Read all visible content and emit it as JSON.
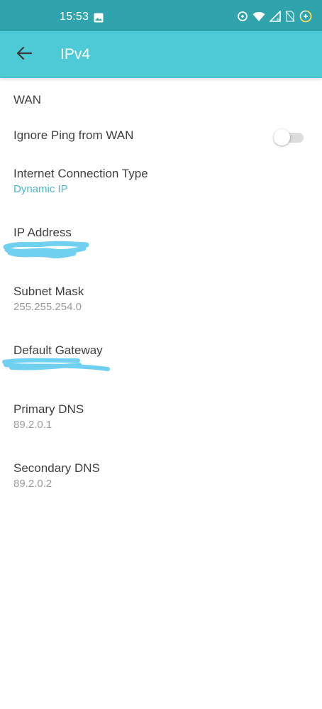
{
  "status_bar": {
    "time": "15:53",
    "icons": [
      "gallery-icon",
      "data-saver-icon",
      "wifi-icon",
      "signal-icon",
      "no-sim-icon",
      "battery-icon"
    ]
  },
  "header": {
    "back_icon": "arrow-back-icon",
    "title": "IPv4"
  },
  "section": {
    "title": "WAN"
  },
  "ignore_ping": {
    "label": "Ignore Ping from WAN",
    "enabled": false
  },
  "fields": {
    "connection_type": {
      "label": "Internet Connection Type",
      "value": "Dynamic IP"
    },
    "ip_address": {
      "label": "IP Address",
      "value": ""
    },
    "subnet_mask": {
      "label": "Subnet Mask",
      "value": "255.255.254.0"
    },
    "default_gateway": {
      "label": "Default Gateway",
      "value": ""
    },
    "primary_dns": {
      "label": "Primary DNS",
      "value": "89.2.0.1"
    },
    "secondary_dns": {
      "label": "Secondary DNS",
      "value": "89.2.0.2"
    }
  },
  "colors": {
    "status_bar": "#2fa4ad",
    "app_bar": "#4ecad6",
    "accent": "#4ab8c6",
    "redaction": "#6fd0f0"
  }
}
